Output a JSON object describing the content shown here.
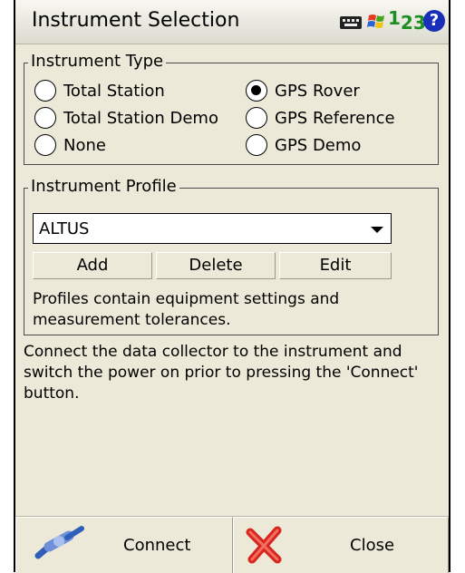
{
  "window": {
    "title": "Instrument Selection",
    "status_icons": [
      "keyboard-icon",
      "windows-flag-icon",
      "numeric-input-icon",
      "help-icon"
    ],
    "numeric_label_main": "1",
    "numeric_label_sub": "23",
    "help_glyph": "?"
  },
  "instrument_type": {
    "legend": "Instrument Type",
    "options": [
      {
        "label": "Total Station",
        "selected": false
      },
      {
        "label": "Total Station Demo",
        "selected": false
      },
      {
        "label": "None",
        "selected": false
      },
      {
        "label": "GPS Rover",
        "selected": true
      },
      {
        "label": "GPS Reference",
        "selected": false
      },
      {
        "label": "GPS Demo",
        "selected": false
      }
    ]
  },
  "instrument_profile": {
    "legend": "Instrument Profile",
    "selected_value": "ALTUS",
    "add_label": "Add",
    "delete_label": "Delete",
    "edit_label": "Edit",
    "note": "Profiles contain equipment settings and measurement tolerances."
  },
  "info_text": "Connect the data collector to the instrument and switch the power on prior to pressing the 'Connect' button.",
  "bottom": {
    "connect_label": "Connect",
    "close_label": "Close"
  },
  "colors": {
    "background": "#ece9d8",
    "help_icon": "#1a2fb9",
    "numeric_icon": "#1c8f24",
    "close_x": "#d9261c"
  }
}
